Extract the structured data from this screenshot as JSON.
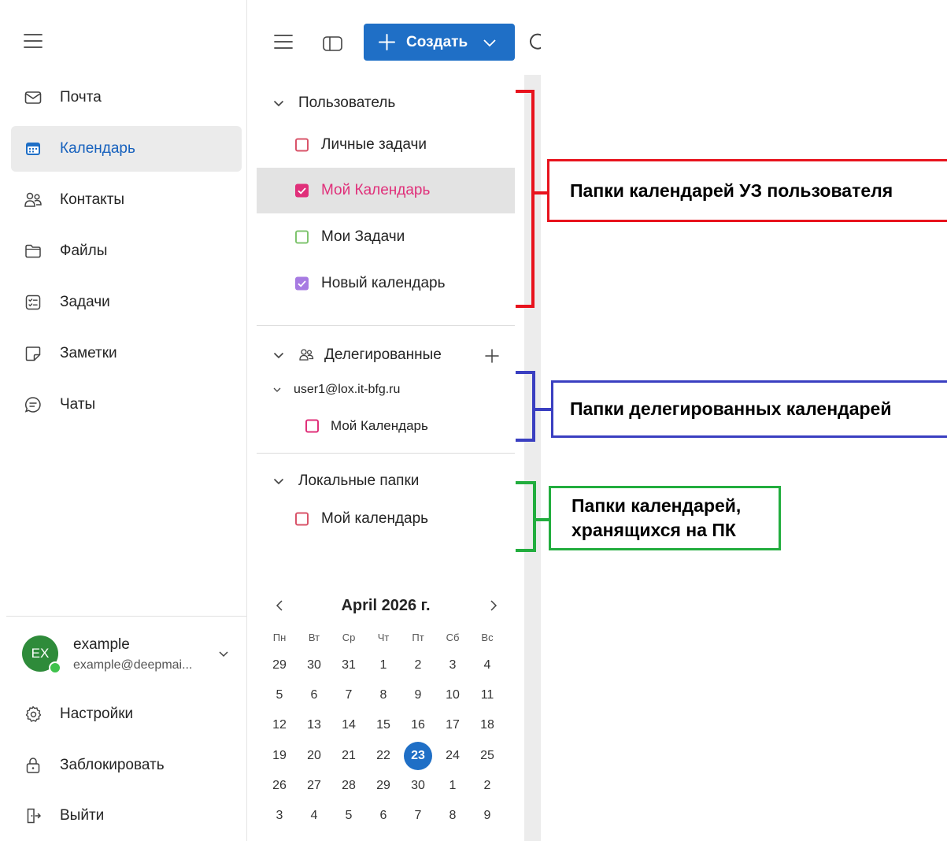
{
  "nav": {
    "items": [
      {
        "label": "Почта",
        "icon": "mail-icon"
      },
      {
        "label": "Календарь",
        "icon": "calendar-icon",
        "active": true
      },
      {
        "label": "Контакты",
        "icon": "contacts-icon"
      },
      {
        "label": "Файлы",
        "icon": "folder-icon"
      },
      {
        "label": "Задачи",
        "icon": "tasks-icon"
      },
      {
        "label": "Заметки",
        "icon": "notes-icon"
      },
      {
        "label": "Чаты",
        "icon": "chat-icon"
      }
    ],
    "account": {
      "initials": "EX",
      "name": "example",
      "email": "example@deepmai..."
    },
    "bottom": [
      {
        "label": "Настройки",
        "icon": "settings-icon"
      },
      {
        "label": "Заблокировать",
        "icon": "lock-icon"
      },
      {
        "label": "Выйти",
        "icon": "sign-out-icon"
      }
    ]
  },
  "toolbar": {
    "create_label": "Создать"
  },
  "groups": {
    "user": {
      "title": "Пользователь",
      "calendars": [
        {
          "name": "Личные задачи",
          "color": "#d9546a",
          "checked": false
        },
        {
          "name": "Мой Календарь",
          "color": "#e0307a",
          "checked": true
        },
        {
          "name": "Мои Задачи",
          "color": "#7fc46f",
          "checked": false
        },
        {
          "name": "Новый календарь",
          "color": "#a77be2",
          "checked": true
        }
      ]
    },
    "delegated": {
      "title": "Делегированные",
      "account": "user1@lox.it-bfg.ru",
      "calendars": [
        {
          "name": "Мой Календарь",
          "color": "#e0307a",
          "checked": false
        }
      ]
    },
    "local": {
      "title": "Локальные папки",
      "calendars": [
        {
          "name": "Мой календарь",
          "color": "#d9546a",
          "checked": false
        }
      ]
    }
  },
  "mini_calendar": {
    "title": "April 2026 г.",
    "weekdays": [
      "Пн",
      "Вт",
      "Ср",
      "Чт",
      "Пт",
      "Сб",
      "Вс"
    ],
    "weeks": [
      [
        "29",
        "30",
        "31",
        "1",
        "2",
        "3",
        "4"
      ],
      [
        "5",
        "6",
        "7",
        "8",
        "9",
        "10",
        "11"
      ],
      [
        "12",
        "13",
        "14",
        "15",
        "16",
        "17",
        "18"
      ],
      [
        "19",
        "20",
        "21",
        "22",
        "23",
        "24",
        "25"
      ],
      [
        "26",
        "27",
        "28",
        "29",
        "30",
        "1",
        "2"
      ],
      [
        "3",
        "4",
        "5",
        "6",
        "7",
        "8",
        "9"
      ]
    ],
    "today": "23"
  },
  "annotations": {
    "user": {
      "lines": [
        "Папки календарей УЗ пользователя"
      ],
      "color": "#e8131d"
    },
    "delegated": {
      "lines": [
        "Папки делегированных календарей"
      ],
      "color": "#3a3fc1"
    },
    "local": {
      "lines": [
        "Папки календарей,",
        "хранящихся на ПК"
      ],
      "color": "#22ad3e"
    }
  }
}
